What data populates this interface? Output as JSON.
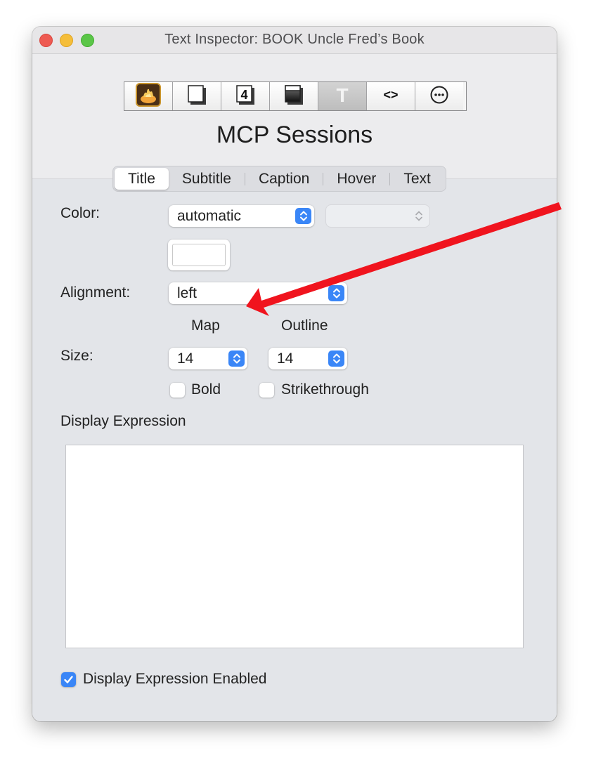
{
  "window": {
    "title": "Text Inspector: BOOK Uncle Fred’s Book"
  },
  "toolbar": {
    "buttons": [
      {
        "name": "general",
        "icon": "fire-icon"
      },
      {
        "name": "appearance",
        "icon": "page-shadow-icon"
      },
      {
        "name": "badge",
        "icon": "number-badge-icon",
        "glyph": "4"
      },
      {
        "name": "border",
        "icon": "frame-icon"
      },
      {
        "name": "text",
        "icon": "text-t-icon",
        "glyph": "T",
        "active": true
      },
      {
        "name": "code",
        "icon": "angle-brackets-icon",
        "glyph": "<>"
      },
      {
        "name": "more",
        "icon": "ellipsis-circle-icon"
      }
    ]
  },
  "heading": "MCP Sessions",
  "tabs": [
    {
      "label": "Title",
      "selected": true
    },
    {
      "label": "Subtitle"
    },
    {
      "label": "Caption"
    },
    {
      "label": "Hover"
    },
    {
      "label": "Text"
    }
  ],
  "form": {
    "color_label": "Color:",
    "color_value": "automatic",
    "color_secondary_value": "",
    "swatch_color": "#ffffff",
    "alignment_label": "Alignment:",
    "alignment_value": "left",
    "map_label": "Map",
    "outline_label": "Outline",
    "size_label": "Size:",
    "map_size": "14",
    "outline_size": "14",
    "bold_label": "Bold",
    "bold_checked": false,
    "strike_label": "Strikethrough",
    "strike_checked": false,
    "display_expression_label": "Display Expression",
    "display_expression_value": "",
    "enabled_label": "Display Expression Enabled",
    "enabled_checked": true
  },
  "colors": {
    "accent": "#3a86f7",
    "annotation_arrow": "#f0141e"
  }
}
